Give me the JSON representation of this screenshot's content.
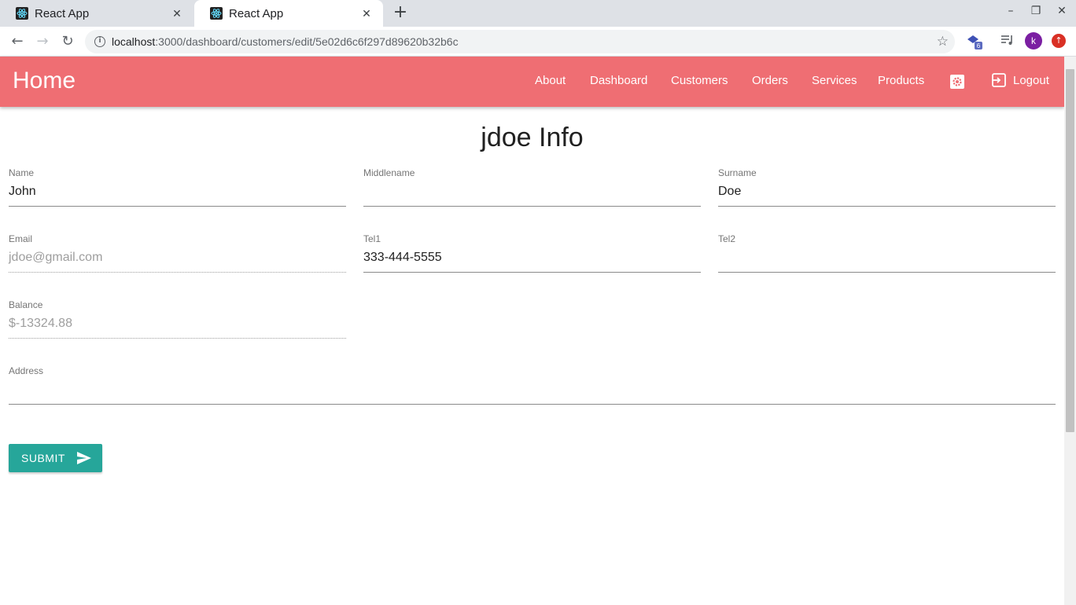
{
  "browser": {
    "tabs": [
      {
        "title": "React App",
        "active": false
      },
      {
        "title": "React App",
        "active": true
      }
    ],
    "url_host": "localhost",
    "url_path": ":3000/dashboard/customers/edit/5e02d6c6f297d89620b32b6c",
    "extension_badge": "6",
    "profile_initial": "k"
  },
  "appbar": {
    "brand": "Home",
    "links": [
      "About",
      "Dashboard",
      "Customers",
      "Orders",
      "Services",
      "Products"
    ],
    "logout_label": "Logout",
    "color": "#ef6e73"
  },
  "form": {
    "title": "jdoe Info",
    "name": {
      "label": "Name",
      "value": "John"
    },
    "middlename": {
      "label": "Middlename",
      "value": ""
    },
    "surname": {
      "label": "Surname",
      "value": "Doe"
    },
    "email": {
      "label": "Email",
      "value": "jdoe@gmail.com"
    },
    "tel1": {
      "label": "Tel1",
      "value": "333-444-5555"
    },
    "tel2": {
      "label": "Tel2",
      "value": ""
    },
    "balance": {
      "label": "Balance",
      "value": "$-13324.88"
    },
    "address": {
      "label": "Address",
      "value": ""
    },
    "submit_label": "SUBMIT",
    "button_color": "#26a69a"
  }
}
